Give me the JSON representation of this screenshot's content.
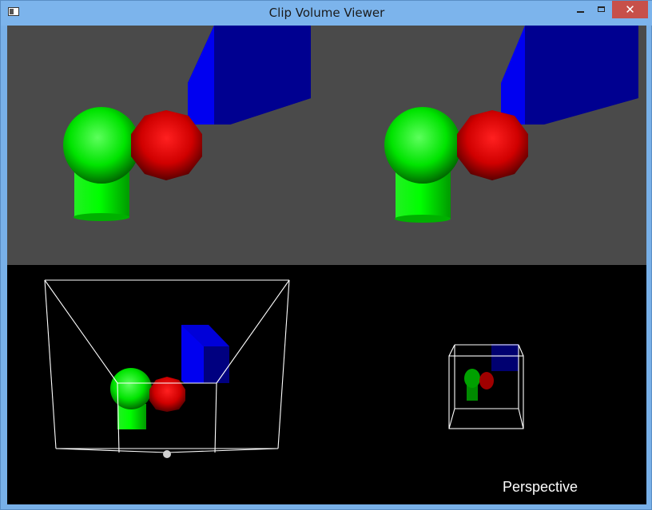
{
  "window": {
    "title": "Clip Volume Viewer",
    "close_glyph": "✕"
  },
  "icons": {
    "app": "app-window-icon",
    "minimize": "minimize-icon",
    "maximize": "maximize-icon",
    "close": "close-icon"
  },
  "colors": {
    "top_background": "#4a4a4a",
    "bottom_background": "#000000",
    "green_object": "#00e000",
    "red_object": "#d00000",
    "blue_object": "#0000c8",
    "wireframe": "#ffffff"
  },
  "labels": {
    "projection_mode": "Perspective"
  }
}
